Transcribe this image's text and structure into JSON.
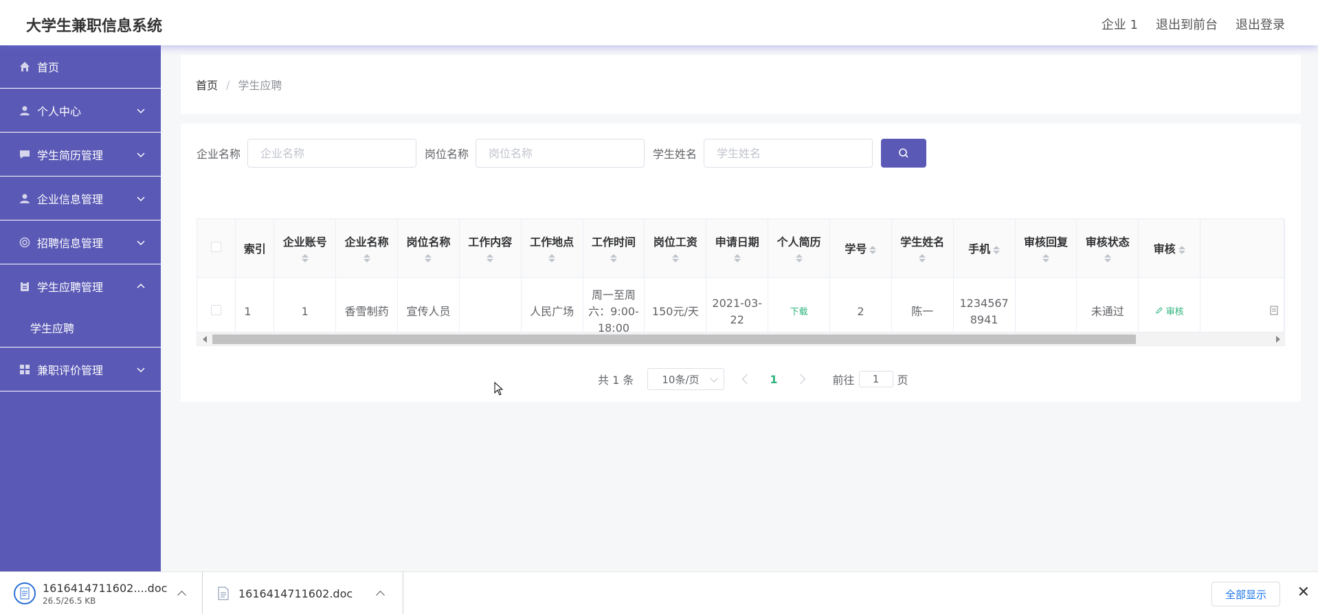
{
  "header": {
    "app_title": "大学生兼职信息系统",
    "user": "企业 1",
    "to_front": "退出到前台",
    "logout": "退出登录"
  },
  "sidebar": {
    "items": [
      {
        "label": "首页",
        "icon": "home-icon"
      },
      {
        "label": "个人中心",
        "icon": "user-icon"
      },
      {
        "label": "学生简历管理",
        "icon": "chat-icon"
      },
      {
        "label": "企业信息管理",
        "icon": "user-icon"
      },
      {
        "label": "招聘信息管理",
        "icon": "target-icon"
      },
      {
        "label": "学生应聘管理",
        "icon": "clipboard-icon",
        "expanded": true
      },
      {
        "label": "兼职评价管理",
        "icon": "grid-icon"
      }
    ],
    "submenu_item": "学生应聘"
  },
  "breadcrumb": {
    "home": "首页",
    "separator": "/",
    "current": "学生应聘"
  },
  "search": {
    "company_label": "企业名称",
    "company_placeholder": "企业名称",
    "post_label": "岗位名称",
    "post_placeholder": "岗位名称",
    "student_label": "学生姓名",
    "student_placeholder": "学生姓名"
  },
  "table": {
    "headers": [
      "索引",
      "企业账号",
      "企业名称",
      "岗位名称",
      "工作内容",
      "工作地点",
      "工作时间",
      "岗位工资",
      "申请日期",
      "个人简历",
      "学号",
      "学生姓名",
      "手机",
      "审核回复",
      "审核状态",
      "审核"
    ],
    "rows": [
      {
        "index": "1",
        "company_account": "1",
        "company_name": "香雪制药",
        "post_name": "宣传人员",
        "work_content": "",
        "work_place": "人民广场",
        "work_time": "周一至周六：9:00-18:00",
        "salary": "150元/天",
        "apply_date": "2021-03-22",
        "resume": "下载",
        "student_no": "2",
        "student_name": "陈一",
        "phone": "12345678941",
        "review_reply": "",
        "review_status": "未通过",
        "review_action": "审核"
      }
    ]
  },
  "pagination": {
    "total": "共 1 条",
    "page_size": "10条/页",
    "current_page": "1",
    "goto_label": "前往",
    "goto_value": "1",
    "page_suffix": "页"
  },
  "downloads": {
    "item1_name": "1616414711602....doc",
    "item1_size": "26.5/26.5 KB",
    "item2_name": "1616414711602.doc",
    "show_all": "全部显示"
  },
  "colors": {
    "sidebar": "#5a59b6",
    "accent_green": "#2bb37b"
  }
}
